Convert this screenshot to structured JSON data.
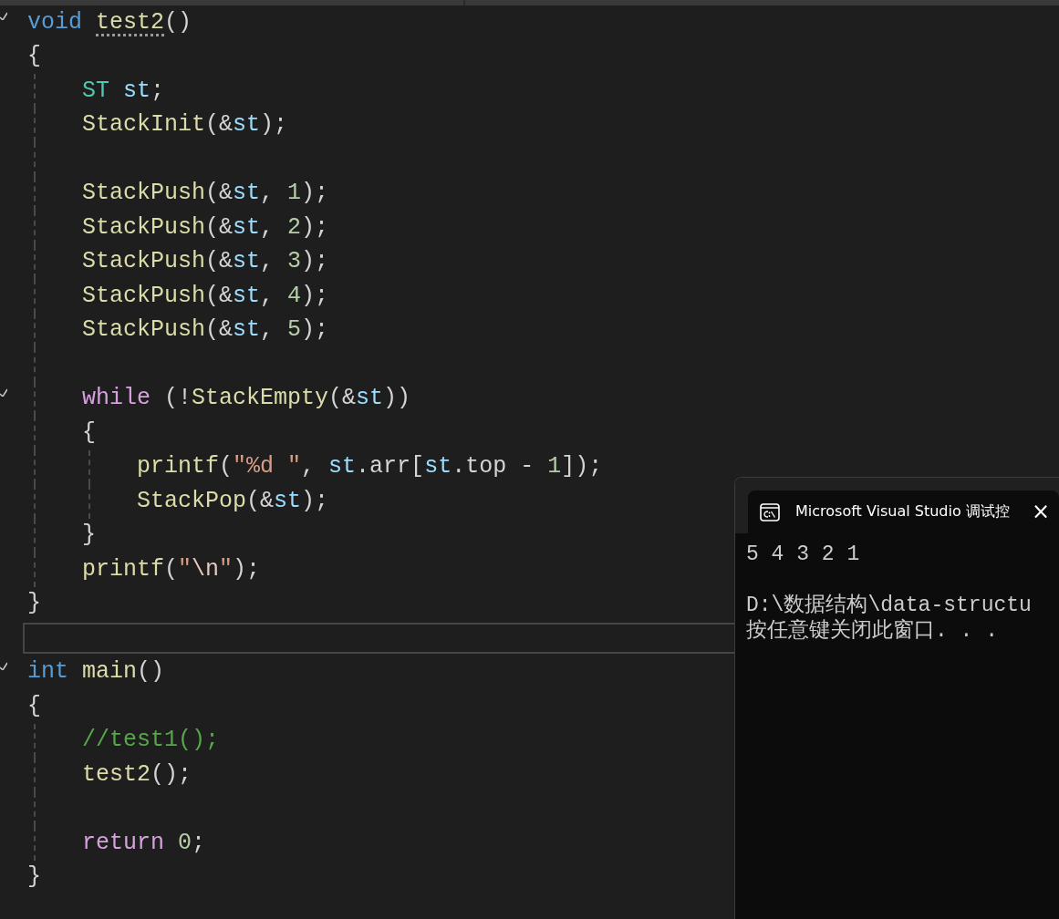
{
  "editor": {
    "lines": [
      {
        "fold": true,
        "tokens": [
          {
            "text": "void ",
            "kind": "kw"
          },
          {
            "text": "test2",
            "kind": "fn",
            "hint": true
          },
          {
            "text": "()",
            "kind": "punct"
          }
        ]
      },
      {
        "tokens": [
          {
            "text": "{",
            "kind": "punct"
          }
        ]
      },
      {
        "tokens": [
          {
            "text": "    ST ",
            "kind": "type"
          },
          {
            "text": "st",
            "kind": "var"
          },
          {
            "text": ";",
            "kind": "punct"
          }
        ]
      },
      {
        "tokens": [
          {
            "text": "    StackInit",
            "kind": "fn"
          },
          {
            "text": "(&",
            "kind": "punct"
          },
          {
            "text": "st",
            "kind": "var"
          },
          {
            "text": ");",
            "kind": "punct"
          }
        ]
      },
      {
        "gap_before": true,
        "tokens": [
          {
            "text": "    StackPush",
            "kind": "fn"
          },
          {
            "text": "(&",
            "kind": "punct"
          },
          {
            "text": "st",
            "kind": "var"
          },
          {
            "text": ", ",
            "kind": "punct"
          },
          {
            "text": "1",
            "kind": "num"
          },
          {
            "text": ");",
            "kind": "punct"
          }
        ]
      },
      {
        "tokens": [
          {
            "text": "    StackPush",
            "kind": "fn"
          },
          {
            "text": "(&",
            "kind": "punct"
          },
          {
            "text": "st",
            "kind": "var"
          },
          {
            "text": ", ",
            "kind": "punct"
          },
          {
            "text": "2",
            "kind": "num"
          },
          {
            "text": ");",
            "kind": "punct"
          }
        ]
      },
      {
        "tokens": [
          {
            "text": "    StackPush",
            "kind": "fn"
          },
          {
            "text": "(&",
            "kind": "punct"
          },
          {
            "text": "st",
            "kind": "var"
          },
          {
            "text": ", ",
            "kind": "punct"
          },
          {
            "text": "3",
            "kind": "num"
          },
          {
            "text": ");",
            "kind": "punct"
          }
        ]
      },
      {
        "tokens": [
          {
            "text": "    StackPush",
            "kind": "fn"
          },
          {
            "text": "(&",
            "kind": "punct"
          },
          {
            "text": "st",
            "kind": "var"
          },
          {
            "text": ", ",
            "kind": "punct"
          },
          {
            "text": "4",
            "kind": "num"
          },
          {
            "text": ");",
            "kind": "punct"
          }
        ]
      },
      {
        "tokens": [
          {
            "text": "    StackPush",
            "kind": "fn"
          },
          {
            "text": "(&",
            "kind": "punct"
          },
          {
            "text": "st",
            "kind": "var"
          },
          {
            "text": ", ",
            "kind": "punct"
          },
          {
            "text": "5",
            "kind": "num"
          },
          {
            "text": ");",
            "kind": "punct"
          }
        ]
      },
      {
        "gap_before": true,
        "fold": true,
        "tokens": [
          {
            "text": "    while ",
            "kind": "ctrl"
          },
          {
            "text": "(!",
            "kind": "punct"
          },
          {
            "text": "StackEmpty",
            "kind": "fn"
          },
          {
            "text": "(&",
            "kind": "punct"
          },
          {
            "text": "st",
            "kind": "var"
          },
          {
            "text": "))",
            "kind": "punct"
          }
        ]
      },
      {
        "tokens": [
          {
            "text": "    {",
            "kind": "punct"
          }
        ]
      },
      {
        "tokens": [
          {
            "text": "        printf",
            "kind": "fn"
          },
          {
            "text": "(",
            "kind": "punct"
          },
          {
            "text": "\"%d \"",
            "kind": "str"
          },
          {
            "text": ", ",
            "kind": "punct"
          },
          {
            "text": "st",
            "kind": "var"
          },
          {
            "text": ".arr[",
            "kind": "punct"
          },
          {
            "text": "st",
            "kind": "var"
          },
          {
            "text": ".top - ",
            "kind": "punct"
          },
          {
            "text": "1",
            "kind": "num"
          },
          {
            "text": "]);",
            "kind": "punct"
          }
        ]
      },
      {
        "tokens": [
          {
            "text": "        StackPop",
            "kind": "fn"
          },
          {
            "text": "(&",
            "kind": "punct"
          },
          {
            "text": "st",
            "kind": "var"
          },
          {
            "text": ");",
            "kind": "punct"
          }
        ]
      },
      {
        "tokens": [
          {
            "text": "    }",
            "kind": "punct"
          }
        ]
      },
      {
        "tokens": [
          {
            "text": "    printf",
            "kind": "fn"
          },
          {
            "text": "(",
            "kind": "punct"
          },
          {
            "text": "\"",
            "kind": "str"
          },
          {
            "text": "\\n",
            "kind": "esc"
          },
          {
            "text": "\"",
            "kind": "str"
          },
          {
            "text": ");",
            "kind": "punct"
          }
        ]
      },
      {
        "tokens": [
          {
            "text": "}",
            "kind": "punct"
          }
        ]
      },
      {
        "current": true
      },
      {
        "fold": true,
        "tokens": [
          {
            "text": "int ",
            "kind": "kw"
          },
          {
            "text": "main",
            "kind": "fn"
          },
          {
            "text": "()",
            "kind": "punct"
          }
        ]
      },
      {
        "tokens": [
          {
            "text": "{",
            "kind": "punct"
          }
        ]
      },
      {
        "tokens": [
          {
            "text": "    //test1();",
            "kind": "cmt"
          }
        ]
      },
      {
        "tokens": [
          {
            "text": "    test2",
            "kind": "fn"
          },
          {
            "text": "();",
            "kind": "punct"
          }
        ]
      },
      {
        "gap_before": true,
        "tokens": [
          {
            "text": "    return ",
            "kind": "ctrl"
          },
          {
            "text": "0",
            "kind": "num"
          },
          {
            "text": ";",
            "kind": "punct"
          }
        ]
      },
      {
        "tokens": [
          {
            "text": "}",
            "kind": "punct"
          }
        ]
      }
    ]
  },
  "console": {
    "tab": {
      "title": "Microsoft Visual Studio 调试控",
      "close": "×"
    },
    "output": [
      {
        "text": "5 4 3 2 1"
      },
      {
        "text": "D:\\数据结构\\data-structu",
        "gap_before": true
      },
      {
        "text": "按任意键关闭此窗口. . ."
      }
    ]
  }
}
